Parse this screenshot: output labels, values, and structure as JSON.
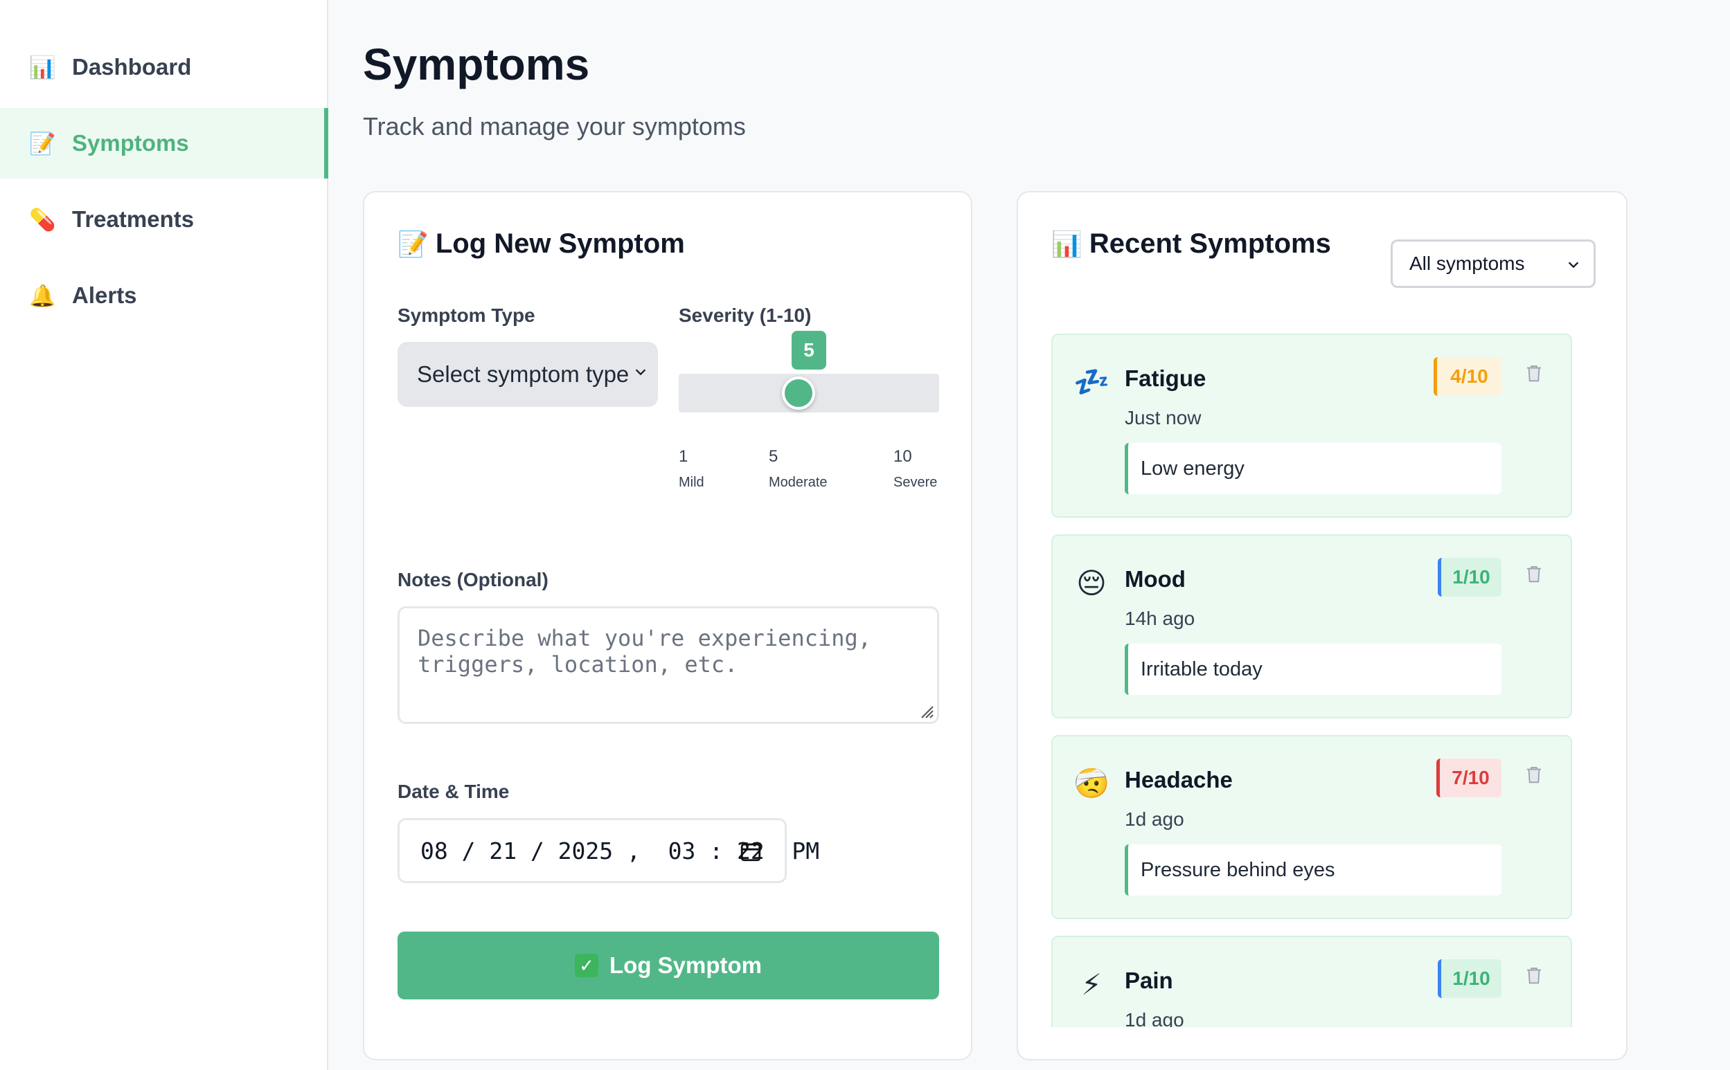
{
  "sidebar": {
    "items": [
      {
        "label": "Dashboard",
        "icon": "📊"
      },
      {
        "label": "Symptoms",
        "icon": "📝"
      },
      {
        "label": "Treatments",
        "icon": "💊"
      },
      {
        "label": "Alerts",
        "icon": "🔔"
      }
    ]
  },
  "header": {
    "title": "Symptoms",
    "subtitle": "Track and manage your symptoms"
  },
  "log_form": {
    "title": "Log New Symptom",
    "title_icon": "📝",
    "symptom_type_label": "Symptom Type",
    "symptom_type_value": "Select symptom type",
    "severity_label": "Severity (1-10)",
    "severity_value": "5",
    "severity_fraction": 0.444,
    "scale": [
      {
        "num": "1",
        "label": "Mild"
      },
      {
        "num": "5",
        "label": "Moderate"
      },
      {
        "num": "10",
        "label": "Severe"
      }
    ],
    "notes_label": "Notes (Optional)",
    "notes_placeholder": "Describe what you're experiencing, triggers, location, etc.",
    "datetime_label": "Date & Time",
    "datetime_value": "08 / 21 / 2025 ,  03 : 22  PM",
    "submit_label": "Log Symptom",
    "submit_icon": "✓"
  },
  "recent": {
    "title": "Recent Symptoms",
    "title_icon": "📊",
    "filter_value": "All symptoms",
    "items": [
      {
        "name": "Fatigue",
        "icon": "💤",
        "time": "Just now",
        "note": "Low energy",
        "severity": "4/10",
        "sev_color": "#f59e0b",
        "sev_bg": "#fdf3dc"
      },
      {
        "name": "Mood",
        "icon": "😔",
        "time": "14h ago",
        "note": "Irritable today",
        "severity": "1/10",
        "sev_color": "#3cb378",
        "sev_bg": "#d9f4e5",
        "sev_border": "#3b82f6"
      },
      {
        "name": "Headache",
        "icon": "🤕",
        "time": "1d ago",
        "note": "Pressure behind eyes",
        "severity": "7/10",
        "sev_color": "#dc3c3c",
        "sev_bg": "#fbe3e3"
      },
      {
        "name": "Pain",
        "icon": "⚡",
        "time": "1d ago",
        "note": "",
        "severity": "1/10",
        "sev_color": "#3cb378",
        "sev_bg": "#d9f4e5",
        "sev_border": "#3b82f6"
      }
    ]
  },
  "colors": {
    "accent": "#52b788",
    "active_bg": "#edfaf2",
    "card_bg": "#edfaf2"
  }
}
